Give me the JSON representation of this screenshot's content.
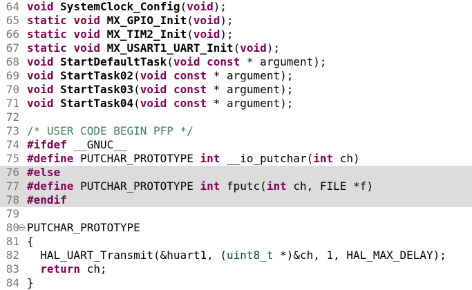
{
  "editor": {
    "colors": {
      "background": "#ffffff",
      "inactive_region": "#dcdcdc",
      "line_number": "#787878",
      "keyword": "#7f0055",
      "comment": "#3f7f5f",
      "type": "#005032",
      "text": "#000000"
    },
    "lines": [
      {
        "num": "64",
        "tokens": [
          {
            "t": "void",
            "k": "kw"
          },
          {
            "t": " "
          },
          {
            "t": "SystemClock_Config",
            "k": "fn"
          },
          {
            "t": "("
          },
          {
            "t": "void",
            "k": "kw"
          },
          {
            "t": ");"
          }
        ]
      },
      {
        "num": "65",
        "tokens": [
          {
            "t": "static",
            "k": "kw"
          },
          {
            "t": " "
          },
          {
            "t": "void",
            "k": "kw"
          },
          {
            "t": " "
          },
          {
            "t": "MX_GPIO_Init",
            "k": "fn"
          },
          {
            "t": "("
          },
          {
            "t": "void",
            "k": "kw"
          },
          {
            "t": ");"
          }
        ]
      },
      {
        "num": "66",
        "tokens": [
          {
            "t": "static",
            "k": "kw"
          },
          {
            "t": " "
          },
          {
            "t": "void",
            "k": "kw"
          },
          {
            "t": " "
          },
          {
            "t": "MX_TIM2_Init",
            "k": "fn"
          },
          {
            "t": "("
          },
          {
            "t": "void",
            "k": "kw"
          },
          {
            "t": ");"
          }
        ]
      },
      {
        "num": "67",
        "tokens": [
          {
            "t": "static",
            "k": "kw"
          },
          {
            "t": " "
          },
          {
            "t": "void",
            "k": "kw"
          },
          {
            "t": " "
          },
          {
            "t": "MX_USART1_UART_Init",
            "k": "fn"
          },
          {
            "t": "("
          },
          {
            "t": "void",
            "k": "kw"
          },
          {
            "t": ");"
          }
        ]
      },
      {
        "num": "68",
        "tokens": [
          {
            "t": "void",
            "k": "kw"
          },
          {
            "t": " "
          },
          {
            "t": "StartDefaultTask",
            "k": "fn"
          },
          {
            "t": "("
          },
          {
            "t": "void",
            "k": "kw"
          },
          {
            "t": " "
          },
          {
            "t": "const",
            "k": "kw"
          },
          {
            "t": " * argument);"
          }
        ]
      },
      {
        "num": "69",
        "tokens": [
          {
            "t": "void",
            "k": "kw"
          },
          {
            "t": " "
          },
          {
            "t": "StartTask02",
            "k": "fn"
          },
          {
            "t": "("
          },
          {
            "t": "void",
            "k": "kw"
          },
          {
            "t": " "
          },
          {
            "t": "const",
            "k": "kw"
          },
          {
            "t": " * argument);"
          }
        ]
      },
      {
        "num": "70",
        "tokens": [
          {
            "t": "void",
            "k": "kw"
          },
          {
            "t": " "
          },
          {
            "t": "StartTask03",
            "k": "fn"
          },
          {
            "t": "("
          },
          {
            "t": "void",
            "k": "kw"
          },
          {
            "t": " "
          },
          {
            "t": "const",
            "k": "kw"
          },
          {
            "t": " * argument);"
          }
        ]
      },
      {
        "num": "71",
        "tokens": [
          {
            "t": "void",
            "k": "kw"
          },
          {
            "t": " "
          },
          {
            "t": "StartTask04",
            "k": "fn"
          },
          {
            "t": "("
          },
          {
            "t": "void",
            "k": "kw"
          },
          {
            "t": " "
          },
          {
            "t": "const",
            "k": "kw"
          },
          {
            "t": " * argument);"
          }
        ]
      },
      {
        "num": "72",
        "tokens": []
      },
      {
        "num": "73",
        "tokens": [
          {
            "t": "/* USER CODE BEGIN PFP */",
            "k": "comment"
          }
        ]
      },
      {
        "num": "74",
        "tokens": [
          {
            "t": "#ifdef",
            "k": "pp"
          },
          {
            "t": " __GNUC__"
          }
        ]
      },
      {
        "num": "75",
        "tokens": [
          {
            "t": "#define",
            "k": "pp"
          },
          {
            "t": " PUTCHAR_PROTOTYPE "
          },
          {
            "t": "int",
            "k": "kw"
          },
          {
            "t": " __io_putchar("
          },
          {
            "t": "int",
            "k": "kw"
          },
          {
            "t": " ch)"
          }
        ]
      },
      {
        "num": "76",
        "inactive": true,
        "tokens": [
          {
            "t": "#else",
            "k": "pp"
          }
        ]
      },
      {
        "num": "77",
        "inactive": true,
        "tokens": [
          {
            "t": "#define",
            "k": "pp"
          },
          {
            "t": " PUTCHAR_PROTOTYPE "
          },
          {
            "t": "int",
            "k": "kw"
          },
          {
            "t": " fputc("
          },
          {
            "t": "int",
            "k": "kw"
          },
          {
            "t": " ch, FILE *f)"
          }
        ]
      },
      {
        "num": "78",
        "inactive": true,
        "tokens": [
          {
            "t": "#endif",
            "k": "pp"
          }
        ]
      },
      {
        "num": "79",
        "tokens": []
      },
      {
        "num": "80",
        "fold": true,
        "tokens": [
          {
            "t": "PUTCHAR_PROTOTYPE"
          }
        ]
      },
      {
        "num": "81",
        "tokens": [
          {
            "t": "{"
          }
        ]
      },
      {
        "num": "82",
        "tokens": [
          {
            "t": "  HAL_UART_Transmit(&huart1, ("
          },
          {
            "t": "uint8_t",
            "k": "type"
          },
          {
            "t": " *)&ch, 1, HAL_MAX_DELAY);"
          }
        ]
      },
      {
        "num": "83",
        "tokens": [
          {
            "t": "  "
          },
          {
            "t": "return",
            "k": "kw"
          },
          {
            "t": " ch;"
          }
        ]
      },
      {
        "num": "84",
        "tokens": [
          {
            "t": "}"
          }
        ]
      }
    ]
  }
}
